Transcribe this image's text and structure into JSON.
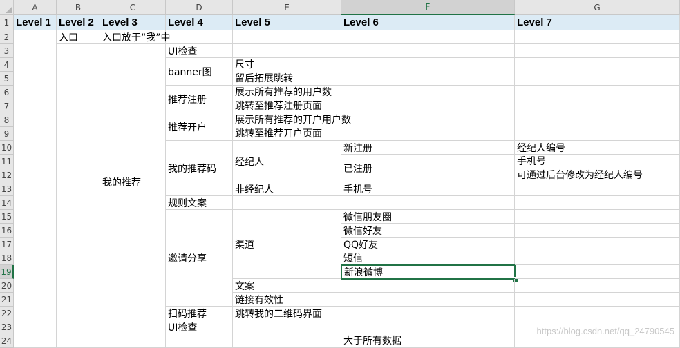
{
  "columns": [
    "A",
    "B",
    "C",
    "D",
    "E",
    "F",
    "G"
  ],
  "selected_column": "F",
  "rows": [
    "1",
    "2",
    "3",
    "4",
    "5",
    "6",
    "7",
    "8",
    "9",
    "10",
    "11",
    "12",
    "13",
    "14",
    "15",
    "16",
    "17",
    "18",
    "19",
    "20",
    "21",
    "22",
    "23",
    "24"
  ],
  "selected_row": "19",
  "header_row": [
    "Level 1",
    "Level 2",
    "Level 3",
    "Level 4",
    "Level 5",
    "Level 6",
    "Level 7"
  ],
  "cells": {
    "b2": "入口",
    "c2": "入口放于“我”中",
    "c_group": "我的推荐",
    "d_ui": "UI检查",
    "d_banner": "banner图",
    "e_size": "尺寸",
    "e_later": "留后拓展跳转",
    "d_reg": "推荐注册",
    "e_reg1": "展示所有推荐的用户数",
    "e_reg2": "跳转至推荐注册页面",
    "d_open": "推荐开户",
    "e_open1": "展示所有推荐的开户用户数",
    "e_open2": "跳转至推荐开户页面",
    "d_code": "我的推荐码",
    "e_broker": "经纪人",
    "f_new": "新注册",
    "g_new": "经纪人编号",
    "f_done": "已注册",
    "g_done1": "手机号",
    "g_done2": "可通过后台修改为经纪人编号",
    "e_nonbroker": "非经纪人",
    "f_phone": "手机号",
    "d_rules": "规则文案",
    "d_share": "邀请分享",
    "e_channel": "渠道",
    "f_wx_moments": "微信朋友圈",
    "f_wx_friend": "微信好友",
    "f_qq": "QQ好友",
    "f_sms": "短信",
    "f_weibo": "新浪微博",
    "e_copy": "文案",
    "e_link": "链接有效性",
    "d_scan": "扫码推荐",
    "e_scan": "跳转我的二维码界面",
    "d_ui2": "UI检查",
    "f_partial": "大于所有数据"
  },
  "watermark": "https://blog.csdn.net/qq_24790545",
  "colors": {
    "accent": "#217346",
    "header_fill": "#dcebf5"
  }
}
